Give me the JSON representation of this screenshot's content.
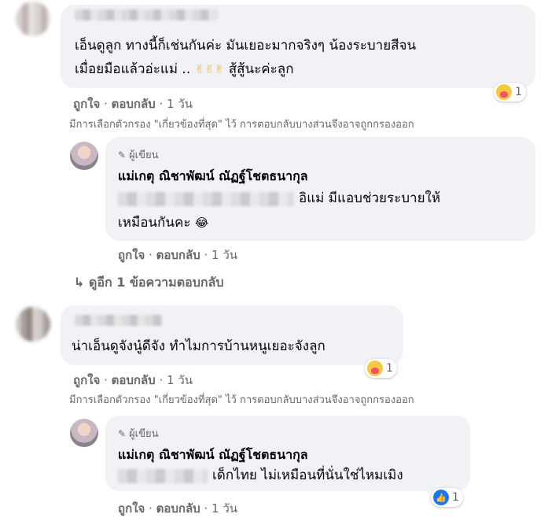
{
  "comment1": {
    "text_line1": "เอ็นดูลูก ทางนี้ก็เช่นกันค่ะ มันเยอะมากจริงๆ น้องระบายสีจน",
    "text_line2": "เมื่อยมือแล้วอ่ะแม่ ..",
    "text_line2_tail": "สู้สู้นะค่ะลูก",
    "emojis": "✌✌✌",
    "reaction_count": "1",
    "like_label": "ถูกใจ",
    "reply_label": "ตอบกลับ",
    "time": "1 วัน",
    "sep": "·",
    "filter_note": "มีการเลือกตัวกรอง \"เกี่ยวข้องที่สุด\" ไว้ การตอบกลับบางส่วนจึงอาจถูกกรองออก"
  },
  "reply1": {
    "badge": "ผู้เขียน",
    "author": "แม่เกตุ ณิชาพัฒน์ ณัฏฐ์โชตธนากุล",
    "text_line1_tail": "อิแม่ มีแอบช่วยระบายให้",
    "text_line2": "เหมือนกันคะ",
    "emoji": "😂",
    "like_label": "ถูกใจ",
    "reply_label": "ตอบกลับ",
    "time": "1 วัน",
    "sep": "·"
  },
  "more_replies": {
    "arrow": "↳",
    "label": "ดูอีก 1 ข้อความตอบกลับ"
  },
  "comment2": {
    "text": "น่าเอ็นดูจังนู๋ดีจัง ทำไมการบ้านหนูเยอะจังลูก",
    "reaction_count": "1",
    "like_label": "ถูกใจ",
    "reply_label": "ตอบกลับ",
    "time": "1 วัน",
    "sep": "·",
    "filter_note": "มีการเลือกตัวกรอง \"เกี่ยวข้องที่สุด\" ไว้ การตอบกลับบางส่วนจึงอาจถูกกรองออก"
  },
  "reply2": {
    "badge": "ผู้เขียน",
    "author": "แม่เกตุ ณิชาพัฒน์ ณัฏฐ์โชตธนากุล",
    "text_tail": "เด็กไทย ไม่เหมือนที่นั่นใช่ไหมเมิง",
    "reaction_count": "1",
    "like_label": "ถูกใจ",
    "reply_label": "ตอบกลับ",
    "time": "1 วัน",
    "sep": "·"
  },
  "icons": {
    "author_badge": "pencil-icon",
    "reaction_care": "care-reaction-icon",
    "reaction_like": "like-reaction-icon",
    "reply_arrow": "reply-arrow-icon"
  },
  "colors": {
    "bubble": "#f0f2f5",
    "secondary_text": "#65676b",
    "like_blue": "#1877f2"
  }
}
